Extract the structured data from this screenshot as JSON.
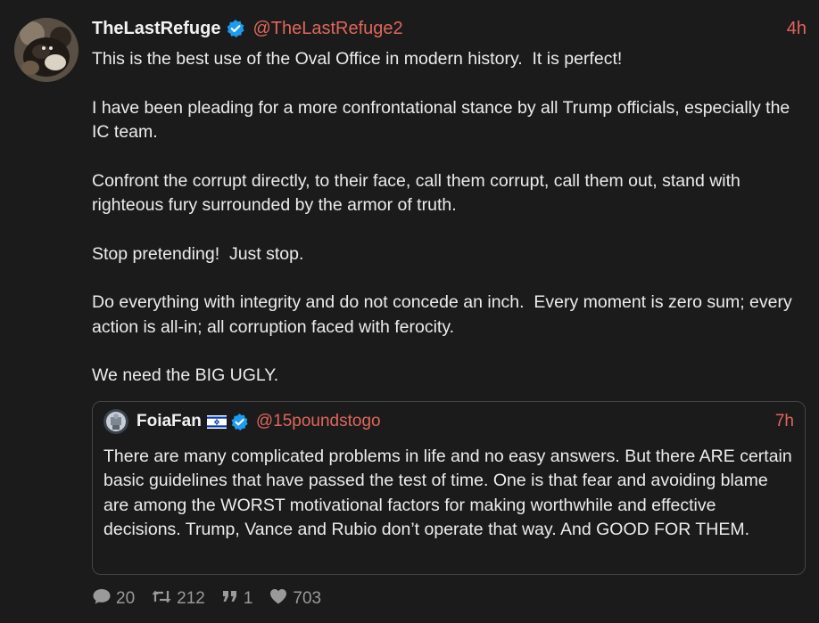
{
  "post": {
    "display_name": "TheLastRefuge",
    "handle": "@TheLastRefuge2",
    "time": "4h",
    "verified_icon": "verified-badge-icon",
    "paragraphs": [
      "This is the best use of the Oval Office in modern history.  It is perfect!",
      "I have been pleading for a more confrontational stance by all Trump officials, especially the IC team.",
      "Confront the corrupt directly, to their face, call them corrupt, call them out, stand with righteous fury surrounded by the armor of truth.",
      "Stop pretending!  Just stop.",
      "Do everything with integrity and do not concede an inch.  Every moment is zero sum; every action is all-in; all corruption faced with ferocity.",
      "We need the BIG UGLY."
    ]
  },
  "quote": {
    "display_name": "FoiaFan",
    "flag_icon": "israel-flag-icon",
    "handle": "@15poundstogo",
    "time": "7h",
    "text": "There are many complicated problems in life and no easy answers. But there ARE certain basic guidelines that have passed the test of time. One is that fear and avoiding blame are among the WORST motivational factors for making worthwhile and effective decisions. Trump, Vance and Rubio don’t operate that way. And GOOD FOR THEM."
  },
  "actions": {
    "replies": "20",
    "reposts": "212",
    "quotes": "1",
    "likes": "703"
  },
  "colors": {
    "background": "#1b1b1b",
    "handle": "#e0665c",
    "verified": "#1d9bf0",
    "muted": "#9a9a9a"
  }
}
